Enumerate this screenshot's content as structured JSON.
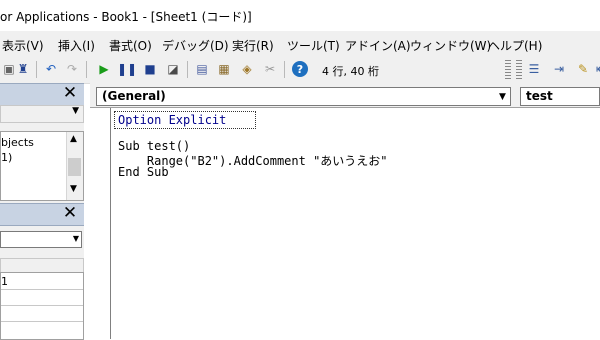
{
  "title": "or Applications - Book1 - [Sheet1 (コード)]",
  "menu": [
    {
      "label": "表示(V)"
    },
    {
      "label": "挿入(I)"
    },
    {
      "label": "書式(O)"
    },
    {
      "label": "デバッグ(D)"
    },
    {
      "label": "実行(R)"
    },
    {
      "label": "ツール(T)"
    },
    {
      "label": "アドイン(A)"
    },
    {
      "label": "ウィンドウ(W)"
    },
    {
      "label": "ヘルプ(H)"
    }
  ],
  "toolbar": {
    "position": "4 行, 40 桁",
    "help_glyph": "?"
  },
  "project": {
    "items": [
      "bjects",
      "1)"
    ]
  },
  "properties": {
    "items": [
      "1"
    ]
  },
  "code": {
    "object_dropdown": "(General)",
    "procedure_dropdown": "test",
    "lines": [
      "Option Explicit",
      "",
      "Sub test()",
      "    Range(\"B2\").AddComment \"あいうえお\"",
      "End Sub"
    ]
  },
  "colors": {
    "keyword": "#00008b",
    "panel_header": "#c8d3e3",
    "run_green": "#1a9c1a",
    "help_blue": "#1e6fbf"
  }
}
